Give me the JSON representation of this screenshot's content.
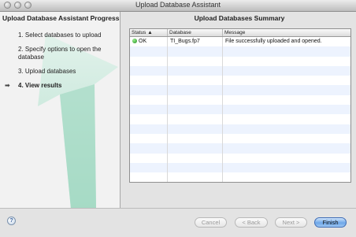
{
  "window": {
    "title": "Upload Database Assistant"
  },
  "left_panel": {
    "title": "Upload Database Assistant Progress",
    "steps": [
      {
        "number": "1.",
        "label": "Select databases to upload"
      },
      {
        "number": "2.",
        "label": "Specify options to open the database"
      },
      {
        "number": "3.",
        "label": "Upload databases"
      },
      {
        "number": "4.",
        "label": "View results",
        "current": true
      }
    ]
  },
  "right_panel": {
    "title": "Upload Databases Summary",
    "table": {
      "columns": [
        "Status",
        "Database",
        "Message"
      ],
      "sorted_column": "Status",
      "sort_indicator": "▲",
      "rows": [
        {
          "status": "OK",
          "status_color": "#2fb02f",
          "database": "TI_Bugs.fp7",
          "message": "File successfully uploaded and opened."
        }
      ],
      "empty_rows": 14
    }
  },
  "footer": {
    "help_glyph": "?",
    "buttons": {
      "cancel": "Cancel",
      "back": "< Back",
      "next": "Next >",
      "finish": "Finish"
    }
  }
}
